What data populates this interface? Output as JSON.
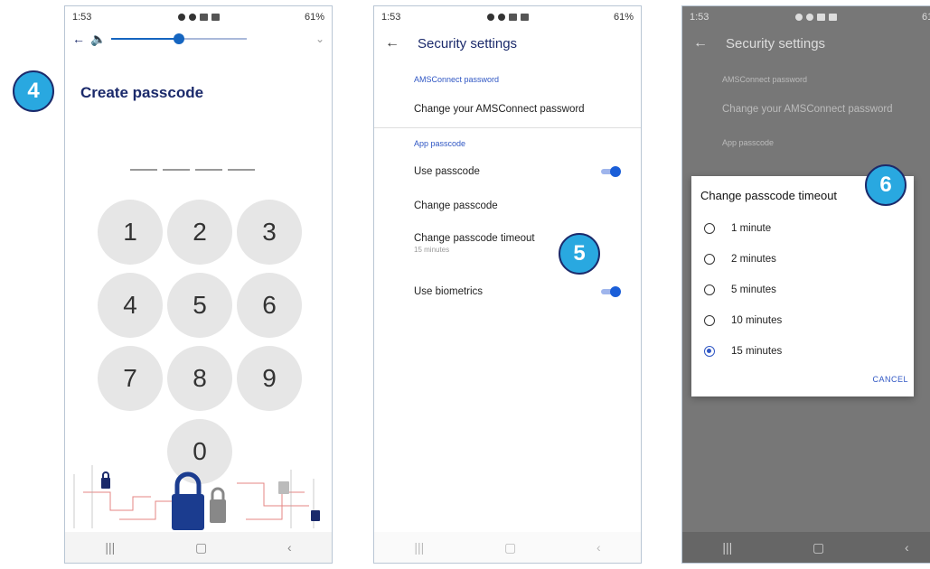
{
  "status": {
    "time": "1:53",
    "battery": "61%"
  },
  "phone1": {
    "title": "Create passcode",
    "keys": [
      "1",
      "2",
      "3",
      "4",
      "5",
      "6",
      "7",
      "8",
      "9",
      "0"
    ],
    "volume_level": 0.5
  },
  "phone2": {
    "header": "Security settings",
    "section1_label": "AMSConnect password",
    "change_password": "Change your AMSConnect password",
    "section2_label": "App passcode",
    "use_passcode": "Use passcode",
    "change_passcode": "Change passcode",
    "change_timeout": "Change passcode timeout",
    "timeout_value": "15 minutes",
    "use_biometrics": "Use biometrics"
  },
  "phone3": {
    "header": "Security settings",
    "section1_label": "AMSConnect password",
    "change_password": "Change your AMSConnect password",
    "section2_label": "App passcode",
    "dialog_title": "Change passcode timeout",
    "options": [
      "1 minute",
      "2 minutes",
      "5 minutes",
      "10 minutes",
      "15 minutes"
    ],
    "selected": "15 minutes",
    "cancel": "CANCEL"
  },
  "badges": [
    "4",
    "5",
    "6"
  ],
  "colors": {
    "accent": "#3057c4",
    "badge": "#29a8e0",
    "navy": "#1b2a6b"
  }
}
